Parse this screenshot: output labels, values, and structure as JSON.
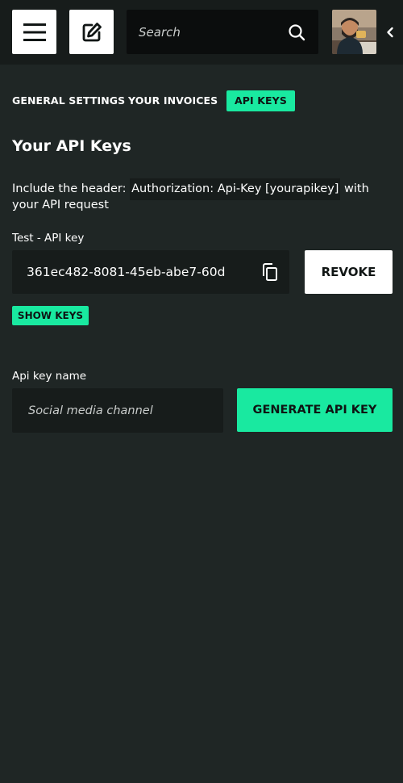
{
  "topbar": {
    "menu_icon": "hamburger-menu-icon",
    "edit_icon": "edit-pencil-icon",
    "search_placeholder": "Search",
    "search_icon": "search-icon",
    "collapse_icon": "chevron-left-icon"
  },
  "tabs": [
    {
      "label": "GENERAL SETTINGS",
      "active": false
    },
    {
      "label": "YOUR INVOICES",
      "active": false
    },
    {
      "label": "API KEYS",
      "active": true
    }
  ],
  "main": {
    "title": "Your API Keys",
    "info_prefix": "Include the header: ",
    "info_code": "Authorization: Api-Key [yourapikey]",
    "info_suffix": " with your API request",
    "test_key_label": "Test - API key",
    "test_key_value": "361ec482-8081-45eb-abe7-60d",
    "copy_icon": "copy-icon",
    "revoke_label": "REVOKE",
    "show_keys_label": "SHOW KEYS",
    "name_label": "Api key name",
    "name_placeholder": "Social media channel",
    "generate_label": "GENERATE API KEY"
  },
  "colors": {
    "background": "#1f2625",
    "topbar": "#171c1b",
    "accent": "#19e9a0",
    "input_bg": "#171c1b"
  }
}
